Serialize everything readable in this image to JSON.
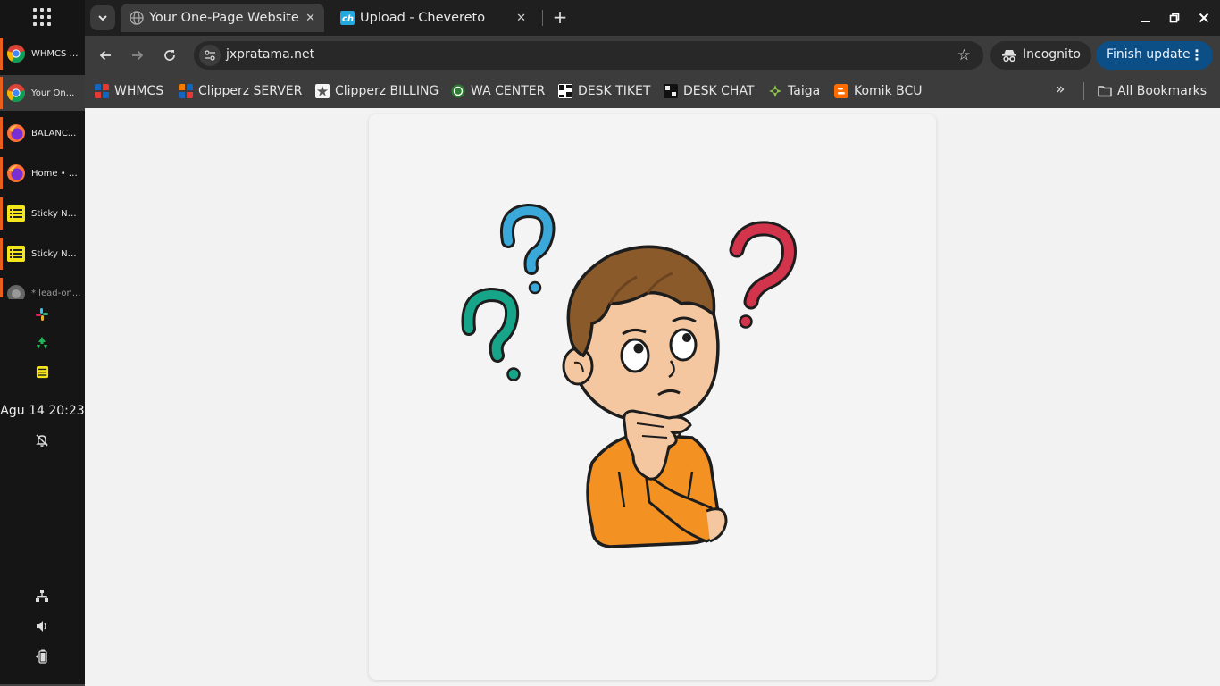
{
  "taskbar": {
    "apps_icon": "apps-grid-icon",
    "windows": [
      {
        "label": "WHMCS - ...",
        "icon": "chrome-icon",
        "active": false
      },
      {
        "label": "Your On...",
        "icon": "chrome-icon",
        "active": true
      },
      {
        "label": "BALANC...",
        "icon": "firefox-icon",
        "active": false
      },
      {
        "label": "Home • T...",
        "icon": "firefox-icon",
        "active": false
      },
      {
        "label": "Sticky No...",
        "icon": "sticky-notes-icon",
        "active": false
      },
      {
        "label": "Sticky No...",
        "icon": "sticky-notes-icon",
        "active": false
      },
      {
        "label": "* lead-on...",
        "icon": "app-icon",
        "active": false
      }
    ],
    "tray": [
      "slack-icon",
      "recycle-icon",
      "sticky-notes-icon"
    ],
    "clock": "Agu 14  20:23",
    "notification_icon": "bell-off-icon",
    "status_icons": [
      "network-icon",
      "volume-icon",
      "battery-icon"
    ]
  },
  "browser": {
    "tabs": [
      {
        "title": "Your One-Page Website",
        "active": true,
        "favicon": "globe-icon"
      },
      {
        "title": "Upload - Chevereto",
        "active": false,
        "favicon": "chevereto-icon"
      }
    ],
    "close_glyph": "✕",
    "new_tab_glyph": "+",
    "url": "jxpratama.net",
    "incognito_label": "Incognito",
    "finish_update_label": "Finish update",
    "bookmarks": [
      {
        "label": "WHMCS",
        "icon_color": "#e53935"
      },
      {
        "label": "Clipperz SERVER",
        "icon_color": "#e53935"
      },
      {
        "label": "Clipperz BILLING",
        "icon_color": "#ffffff"
      },
      {
        "label": "WA CENTER",
        "icon_color": "#2e7d32"
      },
      {
        "label": "DESK TIKET",
        "icon_color": "#ffffff"
      },
      {
        "label": "DESK CHAT",
        "icon_color": "#111111"
      },
      {
        "label": "Taiga",
        "icon_color": "#8bc34a"
      },
      {
        "label": "Komik BCU",
        "icon_color": "#ff6d00"
      }
    ],
    "more_bookmarks_glyph": "»",
    "all_bookmarks_label": "All Bookmarks"
  },
  "page": {
    "illustration": "confused-boy-with-question-marks"
  },
  "colors": {
    "accent_taskbar": "#e8601c",
    "finish_update_bg": "#0b4f86",
    "qmark_blue": "#3aa8d8",
    "qmark_green": "#17a589",
    "qmark_red": "#d2344c",
    "shirt": "#f39223",
    "hair": "#8b5a2b"
  }
}
